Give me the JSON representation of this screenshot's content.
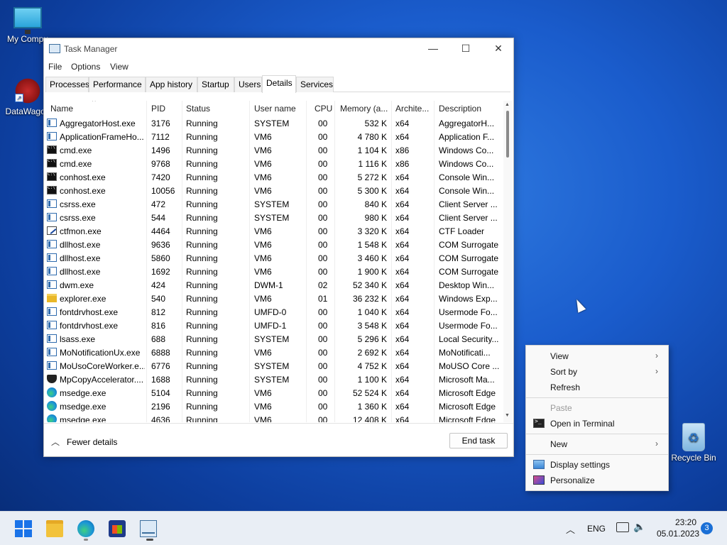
{
  "desktop": {
    "icons": [
      {
        "label": "My Compu"
      },
      {
        "label": "DataWagon"
      },
      {
        "label": "Recycle Bin"
      }
    ]
  },
  "window": {
    "title": "Task Manager",
    "minimize": "—",
    "maximize": "☐",
    "close": "✕"
  },
  "menu": [
    "File",
    "Options",
    "View"
  ],
  "tabs": [
    "Processes",
    "Performance",
    "App history",
    "Startup",
    "Users",
    "Details",
    "Services"
  ],
  "active_tab": "Details",
  "columns": [
    "Name",
    "PID",
    "Status",
    "User name",
    "CPU",
    "Memory (a...",
    "Archite...",
    "Description"
  ],
  "sort_indicator": "^",
  "rows": [
    {
      "icon": "svc",
      "name": "AggregatorHost.exe",
      "pid": "3176",
      "status": "Running",
      "user": "SYSTEM",
      "cpu": "00",
      "mem": "532 K",
      "arch": "x64",
      "desc": "AggregatorH..."
    },
    {
      "icon": "svc",
      "name": "ApplicationFrameHo...",
      "pid": "7112",
      "status": "Running",
      "user": "VM6",
      "cpu": "00",
      "mem": "4 780 K",
      "arch": "x64",
      "desc": "Application F..."
    },
    {
      "icon": "cmd",
      "name": "cmd.exe",
      "pid": "1496",
      "status": "Running",
      "user": "VM6",
      "cpu": "00",
      "mem": "1 104 K",
      "arch": "x86",
      "desc": "Windows Co..."
    },
    {
      "icon": "cmd",
      "name": "cmd.exe",
      "pid": "9768",
      "status": "Running",
      "user": "VM6",
      "cpu": "00",
      "mem": "1 116 K",
      "arch": "x86",
      "desc": "Windows Co..."
    },
    {
      "icon": "cmd",
      "name": "conhost.exe",
      "pid": "7420",
      "status": "Running",
      "user": "VM6",
      "cpu": "00",
      "mem": "5 272 K",
      "arch": "x64",
      "desc": "Console Win..."
    },
    {
      "icon": "cmd",
      "name": "conhost.exe",
      "pid": "10056",
      "status": "Running",
      "user": "VM6",
      "cpu": "00",
      "mem": "5 300 K",
      "arch": "x64",
      "desc": "Console Win..."
    },
    {
      "icon": "svc",
      "name": "csrss.exe",
      "pid": "472",
      "status": "Running",
      "user": "SYSTEM",
      "cpu": "00",
      "mem": "840 K",
      "arch": "x64",
      "desc": "Client Server ..."
    },
    {
      "icon": "svc",
      "name": "csrss.exe",
      "pid": "544",
      "status": "Running",
      "user": "SYSTEM",
      "cpu": "00",
      "mem": "980 K",
      "arch": "x64",
      "desc": "Client Server ..."
    },
    {
      "icon": "pen",
      "name": "ctfmon.exe",
      "pid": "4464",
      "status": "Running",
      "user": "VM6",
      "cpu": "00",
      "mem": "3 320 K",
      "arch": "x64",
      "desc": "CTF Loader"
    },
    {
      "icon": "svc",
      "name": "dllhost.exe",
      "pid": "9636",
      "status": "Running",
      "user": "VM6",
      "cpu": "00",
      "mem": "1 548 K",
      "arch": "x64",
      "desc": "COM Surrogate"
    },
    {
      "icon": "svc",
      "name": "dllhost.exe",
      "pid": "5860",
      "status": "Running",
      "user": "VM6",
      "cpu": "00",
      "mem": "3 460 K",
      "arch": "x64",
      "desc": "COM Surrogate"
    },
    {
      "icon": "svc",
      "name": "dllhost.exe",
      "pid": "1692",
      "status": "Running",
      "user": "VM6",
      "cpu": "00",
      "mem": "1 900 K",
      "arch": "x64",
      "desc": "COM Surrogate"
    },
    {
      "icon": "svc",
      "name": "dwm.exe",
      "pid": "424",
      "status": "Running",
      "user": "DWM-1",
      "cpu": "02",
      "mem": "52 340 K",
      "arch": "x64",
      "desc": "Desktop Win..."
    },
    {
      "icon": "folder",
      "name": "explorer.exe",
      "pid": "540",
      "status": "Running",
      "user": "VM6",
      "cpu": "01",
      "mem": "36 232 K",
      "arch": "x64",
      "desc": "Windows Exp..."
    },
    {
      "icon": "svc",
      "name": "fontdrvhost.exe",
      "pid": "812",
      "status": "Running",
      "user": "UMFD-0",
      "cpu": "00",
      "mem": "1 040 K",
      "arch": "x64",
      "desc": "Usermode Fo..."
    },
    {
      "icon": "svc",
      "name": "fontdrvhost.exe",
      "pid": "816",
      "status": "Running",
      "user": "UMFD-1",
      "cpu": "00",
      "mem": "3 548 K",
      "arch": "x64",
      "desc": "Usermode Fo..."
    },
    {
      "icon": "svc",
      "name": "lsass.exe",
      "pid": "688",
      "status": "Running",
      "user": "SYSTEM",
      "cpu": "00",
      "mem": "5 296 K",
      "arch": "x64",
      "desc": "Local Security..."
    },
    {
      "icon": "svc",
      "name": "MoNotificationUx.exe",
      "pid": "6888",
      "status": "Running",
      "user": "VM6",
      "cpu": "00",
      "mem": "2 692 K",
      "arch": "x64",
      "desc": "MoNotificati..."
    },
    {
      "icon": "svc",
      "name": "MoUsoCoreWorker.e...",
      "pid": "6776",
      "status": "Running",
      "user": "SYSTEM",
      "cpu": "00",
      "mem": "4 752 K",
      "arch": "x64",
      "desc": "MoUSO Core ..."
    },
    {
      "icon": "shield",
      "name": "MpCopyAccelerator....",
      "pid": "1688",
      "status": "Running",
      "user": "SYSTEM",
      "cpu": "00",
      "mem": "1 100 K",
      "arch": "x64",
      "desc": "Microsoft Ma..."
    },
    {
      "icon": "edge",
      "name": "msedge.exe",
      "pid": "5104",
      "status": "Running",
      "user": "VM6",
      "cpu": "00",
      "mem": "52 524 K",
      "arch": "x64",
      "desc": "Microsoft Edge"
    },
    {
      "icon": "edge",
      "name": "msedge.exe",
      "pid": "2196",
      "status": "Running",
      "user": "VM6",
      "cpu": "00",
      "mem": "1 360 K",
      "arch": "x64",
      "desc": "Microsoft Edge"
    },
    {
      "icon": "edge",
      "name": "msedge.exe",
      "pid": "4636",
      "status": "Running",
      "user": "VM6",
      "cpu": "00",
      "mem": "12 408 K",
      "arch": "x64",
      "desc": "Microsoft Edge"
    }
  ],
  "footer": {
    "fewer_details": "Fewer details",
    "end_task": "End task"
  },
  "context_menu": [
    {
      "label": "View",
      "submenu": true
    },
    {
      "label": "Sort by",
      "submenu": true
    },
    {
      "label": "Refresh"
    },
    {
      "label": "Paste",
      "disabled": true
    },
    {
      "label": "Open in Terminal",
      "icon": "terminal-icon"
    },
    {
      "label": "New",
      "submenu": true
    },
    {
      "label": "Display settings",
      "icon": "display-settings-icon"
    },
    {
      "label": "Personalize",
      "icon": "personalize-icon"
    }
  ],
  "tray": {
    "language": "ENG",
    "time": "23:20",
    "date": "05.01.2023",
    "notifications": "3"
  },
  "colors": {
    "accent": "#1a73e8",
    "desktop": "#1a5ccc"
  }
}
